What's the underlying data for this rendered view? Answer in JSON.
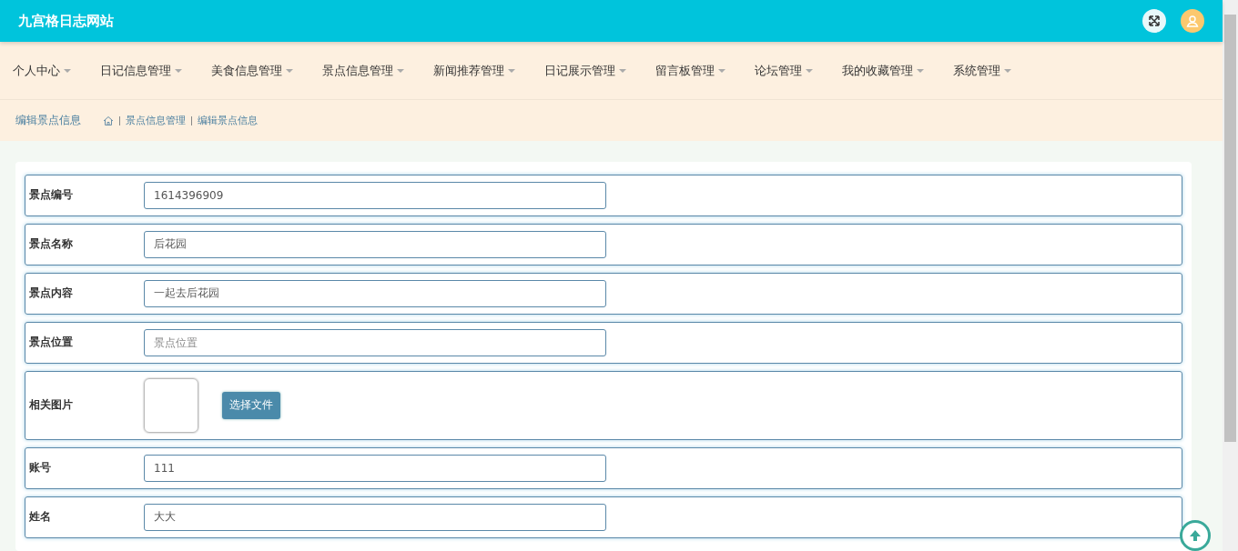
{
  "header": {
    "title": "九宫格日志网站"
  },
  "nav": {
    "items": [
      {
        "label": "个人中心"
      },
      {
        "label": "日记信息管理"
      },
      {
        "label": "美食信息管理"
      },
      {
        "label": "景点信息管理"
      },
      {
        "label": "新闻推荐管理"
      },
      {
        "label": "日记展示管理"
      },
      {
        "label": "留言板管理"
      },
      {
        "label": "论坛管理"
      },
      {
        "label": "我的收藏管理"
      },
      {
        "label": "系统管理"
      }
    ]
  },
  "breadcrumb": {
    "title": "编辑景点信息",
    "path": [
      "景点信息管理",
      "编辑景点信息"
    ]
  },
  "form": {
    "fields": [
      {
        "kind": "input",
        "label": "景点编号",
        "value": "1614396909"
      },
      {
        "kind": "input",
        "label": "景点名称",
        "value": "后花园"
      },
      {
        "kind": "input",
        "label": "景点内容",
        "value": "一起去后花园"
      },
      {
        "kind": "input",
        "label": "景点位置",
        "placeholder": "景点位置"
      },
      {
        "kind": "image",
        "label": "相关图片",
        "button": "选择文件"
      },
      {
        "kind": "input",
        "label": "账号",
        "value": "111"
      },
      {
        "kind": "input",
        "label": "姓名",
        "value": "大大"
      }
    ]
  }
}
